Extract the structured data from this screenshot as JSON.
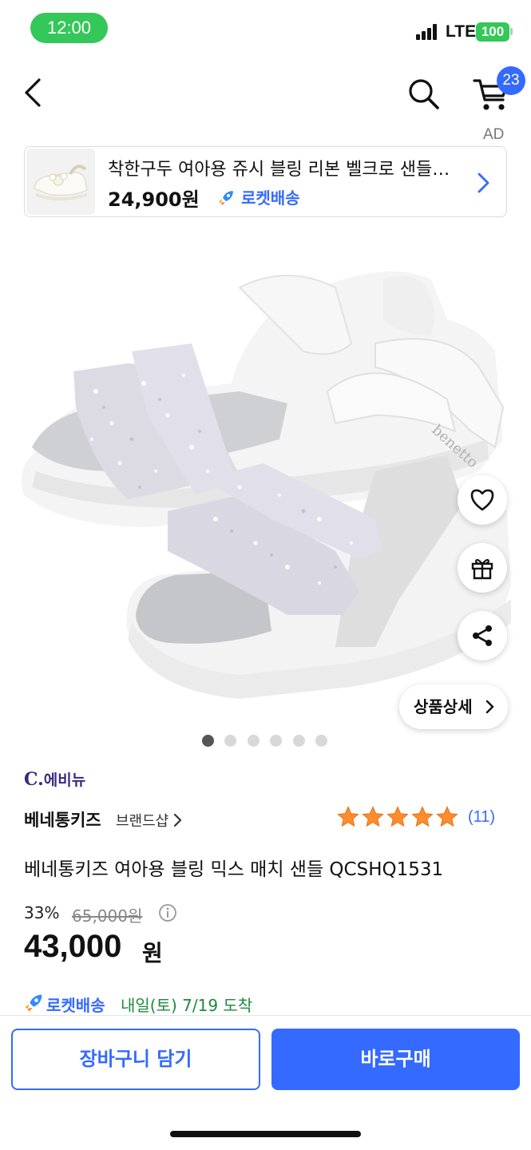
{
  "status_bar": {
    "time": "12:00",
    "network": "LTE",
    "battery": "100",
    "icons": [
      "signal-icon",
      "battery-icon"
    ]
  },
  "nav": {
    "icons": [
      "back-chevron-icon",
      "search-icon",
      "cart-icon"
    ],
    "cart_count": "23",
    "ad_label": "AD"
  },
  "ad_banner": {
    "title": "착한구두 여아용 쥬시 블링 리본 벨크로 샌들…",
    "price": "24,900원",
    "rocket_label": "로켓배송",
    "icons": [
      "rocket-icon",
      "chevron-right-icon"
    ]
  },
  "hero": {
    "icons": [
      "heart-icon",
      "gift-icon",
      "share-icon"
    ],
    "detail_label": "상품상세",
    "slide_count": 6,
    "active_slide": 1
  },
  "product": {
    "seller_logo_c": "C.",
    "seller_logo_text": "에비뉴",
    "brand": "베네통키즈",
    "brand_shop": "브랜드샵",
    "rating": 5,
    "review_count": "(11)",
    "title": "베네통키즈 여아용 블링 믹스 매치 샌들 QCSHQ1531",
    "discount": "33%",
    "original_price": "65,000원",
    "sale_price_number": "43,000",
    "sale_price_unit": "원",
    "delivery_badge": "로켓배송",
    "delivery_text": "내일(토) 7/19 도착"
  },
  "bottom": {
    "cart_button": "장바구니 담기",
    "buy_button": "바로구매"
  },
  "colors": {
    "accent": "#346aff",
    "status_green": "#34c759",
    "delivery_green": "#1d8a3c",
    "star": "#ff8c2e"
  }
}
